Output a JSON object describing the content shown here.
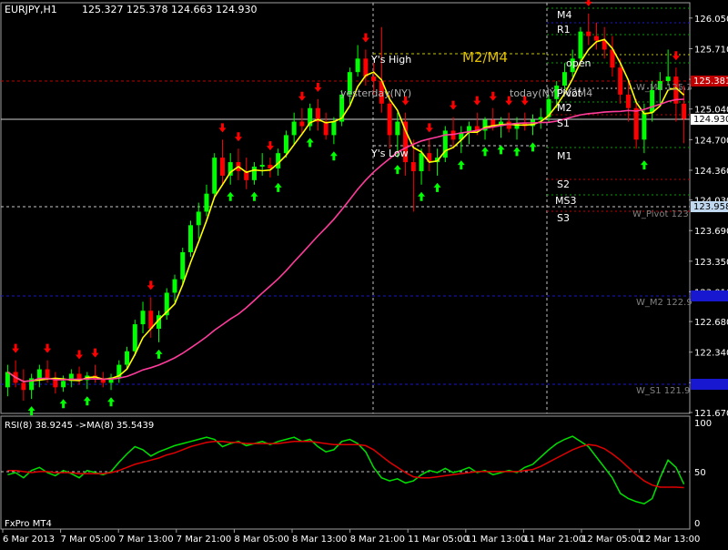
{
  "header": {
    "symbol_label": "EURJPY,H1",
    "ohlc_label": "125.327 125.378 124.663 124.930"
  },
  "price_axis": {
    "ticks": [
      "126.050",
      "125.710",
      "125.370",
      "125.040",
      "124.700",
      "124.360",
      "124.030",
      "123.690",
      "123.350",
      "123.010",
      "122.680",
      "122.340",
      "122.000",
      "121.670"
    ],
    "current_price": "124.930",
    "current_bg": "#ffffff",
    "marker_red": "125.381",
    "marker_blue_mid": "123.958",
    "marker_blue_low1": "123.0??",
    "marker_blue_low2": "122.1??"
  },
  "time_axis": {
    "ticks": [
      "6 Mar 2013",
      "7 Mar 05:00",
      "7 Mar 13:00",
      "7 Mar 21:00",
      "8 Mar 05:00",
      "8 Mar 13:00",
      "8 Mar 21:00",
      "11 Mar 05:00",
      "11 Mar 13:00",
      "11 Mar 21:00",
      "12 Mar 05:00",
      "12 Mar 13:00"
    ]
  },
  "chart_labels": {
    "ys_high": "Y's High",
    "ys_low": "Y's Low",
    "m2m4": "M2/M4",
    "yesterday_ny": "yesterday(NY)",
    "today_ny": "today(NY) M2M4",
    "m4": "M4",
    "r1": "R1",
    "open": "open",
    "pivot": "Pivot",
    "m2": "M2",
    "s1": "S1",
    "m1": "M1",
    "s2": "S2",
    "ms3": "MS3",
    "s3": "S3",
    "w_m3": "W_M3 125.3",
    "w_pivot": "W_Pivot 123",
    "w_m2": "W_M2 122.9",
    "w_s1": "W_S1 121.9"
  },
  "rsi": {
    "label": "RSI(8) 38.9245   ->MA(8) 35.5439",
    "ticks": [
      "100",
      "50",
      "0"
    ]
  },
  "footer": {
    "broker_label": "FxPro MT4"
  },
  "colors": {
    "background": "#000000",
    "bull_candle": "#00ff00",
    "bear_candle": "#ff0000",
    "ma_fast": "#ffff00",
    "ma_slow": "#ff3c9c",
    "rsi_line": "#00e000",
    "rsi_ma": "#e00000",
    "grid_white": "#c0c0c0",
    "level_yellow": "#c8c800",
    "level_green": "#00a000",
    "level_red": "#c00000",
    "level_blue": "#1818d0"
  },
  "chart_data": [
    {
      "type": "candlestick",
      "symbol": "EURJPY",
      "timeframe": "H1",
      "ylim": [
        121.67,
        126.21
      ],
      "overlays": [
        "MA fast (yellow)",
        "MA slow (magenta)"
      ],
      "candles": [
        [
          121.95,
          122.2,
          121.85,
          122.12
        ],
        [
          122.12,
          122.25,
          121.95,
          122.0
        ],
        [
          122.0,
          122.15,
          121.8,
          121.92
        ],
        [
          121.92,
          122.1,
          121.82,
          122.05
        ],
        [
          122.05,
          122.2,
          121.95,
          122.15
        ],
        [
          122.15,
          122.25,
          122.0,
          122.05
        ],
        [
          122.05,
          122.12,
          121.88,
          121.95
        ],
        [
          121.95,
          122.08,
          121.9,
          122.02
        ],
        [
          122.02,
          122.15,
          121.95,
          122.1
        ],
        [
          122.1,
          122.18,
          121.98,
          122.03
        ],
        [
          122.03,
          122.12,
          121.93,
          122.08
        ],
        [
          122.08,
          122.2,
          122.0,
          122.05
        ],
        [
          122.05,
          122.12,
          121.95,
          122.0
        ],
        [
          122.0,
          122.1,
          121.92,
          122.06
        ],
        [
          122.06,
          122.25,
          122.0,
          122.2
        ],
        [
          122.2,
          122.4,
          122.15,
          122.35
        ],
        [
          122.35,
          122.7,
          122.3,
          122.65
        ],
        [
          122.65,
          122.9,
          122.55,
          122.8
        ],
        [
          122.8,
          122.95,
          122.5,
          122.6
        ],
        [
          122.6,
          122.8,
          122.45,
          122.75
        ],
        [
          122.75,
          123.05,
          122.7,
          123.0
        ],
        [
          123.0,
          123.2,
          122.9,
          123.15
        ],
        [
          123.15,
          123.5,
          123.1,
          123.45
        ],
        [
          123.45,
          123.8,
          123.4,
          123.75
        ],
        [
          123.75,
          124.0,
          123.6,
          123.9
        ],
        [
          123.9,
          124.2,
          123.85,
          124.1
        ],
        [
          124.1,
          124.55,
          124.05,
          124.5
        ],
        [
          124.5,
          124.7,
          124.2,
          124.3
        ],
        [
          124.3,
          124.55,
          124.2,
          124.45
        ],
        [
          124.45,
          124.6,
          124.25,
          124.35
        ],
        [
          124.35,
          124.5,
          124.15,
          124.25
        ],
        [
          124.25,
          124.45,
          124.2,
          124.4
        ],
        [
          124.4,
          124.55,
          124.3,
          124.42
        ],
        [
          124.42,
          124.5,
          124.28,
          124.38
        ],
        [
          124.38,
          124.6,
          124.3,
          124.55
        ],
        [
          124.55,
          124.8,
          124.5,
          124.75
        ],
        [
          124.75,
          125.0,
          124.65,
          124.9
        ],
        [
          124.9,
          125.05,
          124.75,
          124.85
        ],
        [
          124.85,
          125.1,
          124.8,
          125.05
        ],
        [
          125.05,
          125.15,
          124.8,
          124.9
        ],
        [
          124.9,
          125.0,
          124.7,
          124.75
        ],
        [
          124.75,
          124.95,
          124.65,
          124.9
        ],
        [
          124.9,
          125.25,
          124.85,
          125.2
        ],
        [
          125.2,
          125.5,
          125.1,
          125.45
        ],
        [
          125.45,
          125.75,
          125.4,
          125.6
        ],
        [
          125.6,
          125.7,
          125.3,
          125.4
        ],
        [
          125.4,
          125.55,
          125.2,
          125.35
        ],
        [
          125.35,
          125.95,
          125.0,
          125.1
        ],
        [
          125.1,
          125.2,
          124.6,
          124.75
        ],
        [
          124.75,
          125.0,
          124.5,
          124.9
        ],
        [
          124.9,
          125.0,
          124.3,
          124.45
        ],
        [
          124.45,
          124.7,
          123.9,
          124.35
        ],
        [
          124.35,
          124.6,
          124.2,
          124.55
        ],
        [
          124.55,
          124.7,
          124.35,
          124.45
        ],
        [
          124.45,
          124.6,
          124.3,
          124.5
        ],
        [
          124.5,
          124.85,
          124.45,
          124.8
        ],
        [
          124.8,
          124.95,
          124.6,
          124.7
        ],
        [
          124.7,
          124.85,
          124.55,
          124.78
        ],
        [
          124.78,
          124.9,
          124.65,
          124.85
        ],
        [
          124.85,
          125.0,
          124.75,
          124.8
        ],
        [
          124.8,
          124.95,
          124.7,
          124.92
        ],
        [
          124.92,
          125.05,
          124.8,
          124.85
        ],
        [
          124.85,
          124.95,
          124.72,
          124.9
        ],
        [
          124.9,
          125.0,
          124.78,
          124.82
        ],
        [
          124.82,
          124.95,
          124.7,
          124.88
        ],
        [
          124.88,
          125.0,
          124.8,
          124.85
        ],
        [
          124.85,
          124.98,
          124.75,
          124.92
        ],
        [
          124.92,
          125.05,
          124.82,
          124.95
        ],
        [
          124.95,
          125.2,
          124.9,
          125.15
        ],
        [
          125.15,
          125.35,
          125.05,
          125.3
        ],
        [
          125.3,
          125.55,
          125.25,
          125.45
        ],
        [
          125.45,
          125.7,
          125.4,
          125.6
        ],
        [
          125.6,
          125.95,
          125.55,
          125.9
        ],
        [
          125.9,
          126.1,
          125.75,
          125.85
        ],
        [
          125.85,
          126.0,
          125.7,
          125.8
        ],
        [
          125.8,
          125.95,
          125.6,
          125.7
        ],
        [
          125.7,
          125.85,
          125.4,
          125.5
        ],
        [
          125.5,
          125.6,
          125.1,
          125.2
        ],
        [
          125.2,
          125.35,
          124.9,
          125.05
        ],
        [
          125.05,
          125.15,
          124.6,
          124.7
        ],
        [
          124.7,
          125.1,
          124.55,
          125.0
        ],
        [
          125.0,
          125.35,
          124.9,
          125.25
        ],
        [
          125.25,
          125.45,
          125.1,
          125.35
        ],
        [
          125.35,
          125.7,
          125.3,
          125.4
        ],
        [
          125.4,
          125.5,
          124.9,
          125.1
        ],
        [
          125.1,
          125.3,
          124.66,
          124.93
        ]
      ]
    },
    {
      "type": "line",
      "title": "RSI(8) 38.9245 ->MA(8) 35.5439",
      "ylim": [
        0,
        100
      ],
      "ticks": [
        100,
        50,
        0
      ],
      "series": [
        {
          "name": "RSI(8)",
          "values": [
            48,
            50,
            45,
            52,
            55,
            50,
            47,
            52,
            49,
            45,
            52,
            50,
            48,
            51,
            60,
            68,
            75,
            72,
            66,
            70,
            73,
            76,
            78,
            80,
            82,
            84,
            82,
            75,
            78,
            80,
            76,
            78,
            80,
            77,
            80,
            82,
            84,
            80,
            82,
            75,
            70,
            72,
            80,
            82,
            78,
            70,
            55,
            45,
            42,
            44,
            40,
            42,
            48,
            52,
            50,
            54,
            50,
            52,
            55,
            50,
            52,
            48,
            50,
            52,
            50,
            55,
            58,
            65,
            72,
            78,
            82,
            85,
            80,
            75,
            65,
            55,
            45,
            30,
            25,
            22,
            20,
            25,
            45,
            62,
            55,
            38.9
          ]
        },
        {
          "name": "MA(8)",
          "values": [
            52,
            52,
            51,
            50,
            51,
            51,
            50,
            50,
            50,
            49,
            49,
            49,
            49,
            50,
            52,
            55,
            58,
            60,
            62,
            64,
            67,
            69,
            72,
            75,
            77,
            79,
            80,
            80,
            79,
            79,
            78,
            78,
            78,
            78,
            78,
            79,
            80,
            80,
            80,
            79,
            78,
            77,
            77,
            77,
            77,
            76,
            72,
            66,
            60,
            55,
            50,
            46,
            45,
            45,
            46,
            47,
            48,
            49,
            50,
            51,
            51,
            51,
            51,
            51,
            51,
            52,
            53,
            56,
            60,
            64,
            68,
            72,
            75,
            77,
            76,
            73,
            68,
            62,
            55,
            48,
            42,
            38,
            36,
            36,
            36,
            35.5
          ]
        }
      ]
    }
  ]
}
